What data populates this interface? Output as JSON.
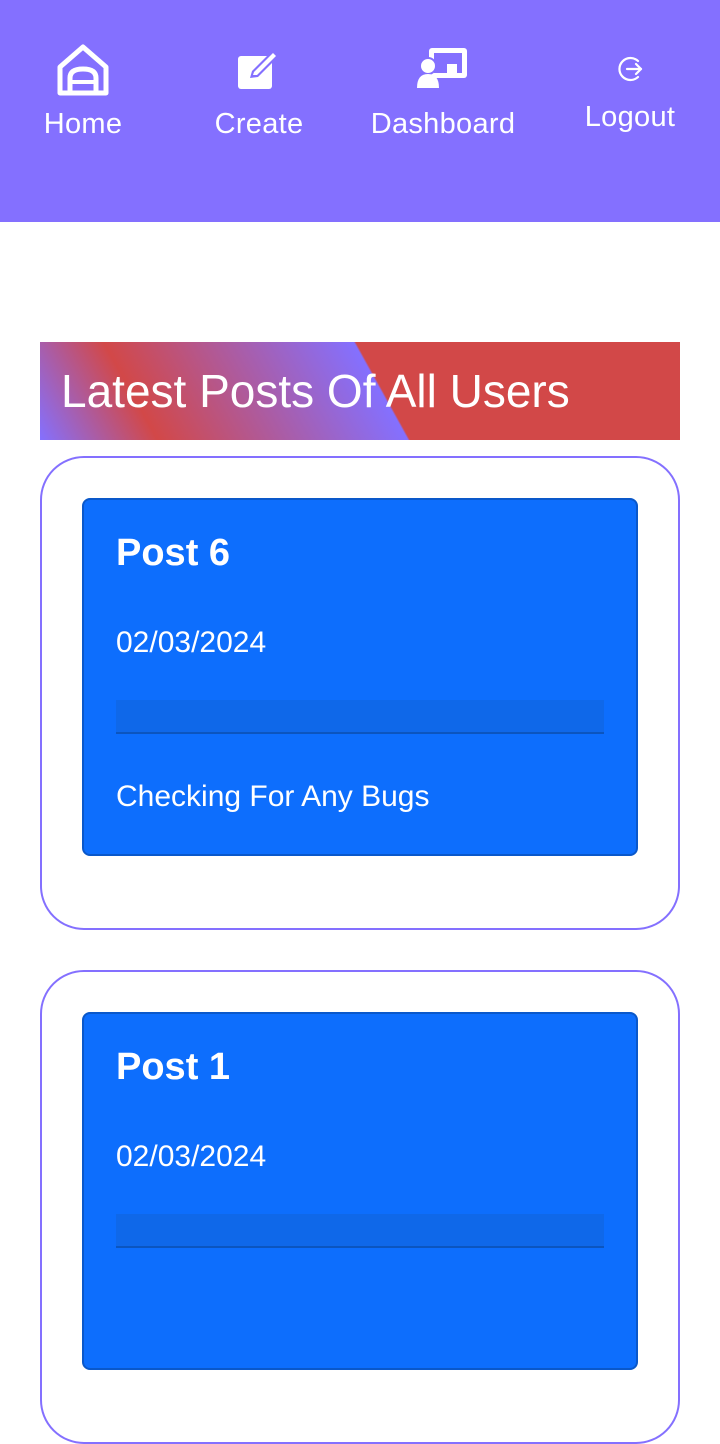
{
  "colors": {
    "navbar_bg": "#8470ff",
    "banner_red": "#d24848",
    "card_border": "#8470ff",
    "post_bg": "#0d6efd",
    "text_light": "#ffffff"
  },
  "nav": {
    "items": [
      {
        "label": "Home",
        "icon": "home-icon"
      },
      {
        "label": "Create",
        "icon": "edit-icon"
      },
      {
        "label": "Dashboard",
        "icon": "dashboard-icon"
      },
      {
        "label": "Logout",
        "icon": "logout-icon"
      }
    ]
  },
  "section": {
    "title": "Latest Posts Of All Users"
  },
  "posts": [
    {
      "title": "Post 6",
      "date": "02/03/2024",
      "body": "Checking For Any Bugs"
    },
    {
      "title": "Post 1",
      "date": "02/03/2024",
      "body": ""
    }
  ]
}
